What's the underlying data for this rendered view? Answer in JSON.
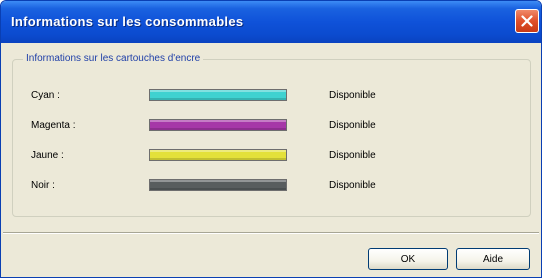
{
  "window": {
    "title": "Informations sur les consommables"
  },
  "group": {
    "legend": "Informations sur les cartouches d'encre"
  },
  "inks": [
    {
      "label": "Cyan :",
      "color": "#3fd2d0",
      "level": 1.0,
      "status": "Disponible"
    },
    {
      "label": "Magenta :",
      "color": "#a637a8",
      "level": 1.0,
      "status": "Disponible"
    },
    {
      "label": "Jaune :",
      "color": "#e3e13a",
      "level": 1.0,
      "status": "Disponible"
    },
    {
      "label": "Noir :",
      "color": "#585d5e",
      "level": 1.0,
      "status": "Disponible"
    }
  ],
  "buttons": {
    "ok_label": "OK",
    "help_label": "Aide"
  },
  "icons": {
    "close": "close-icon"
  }
}
